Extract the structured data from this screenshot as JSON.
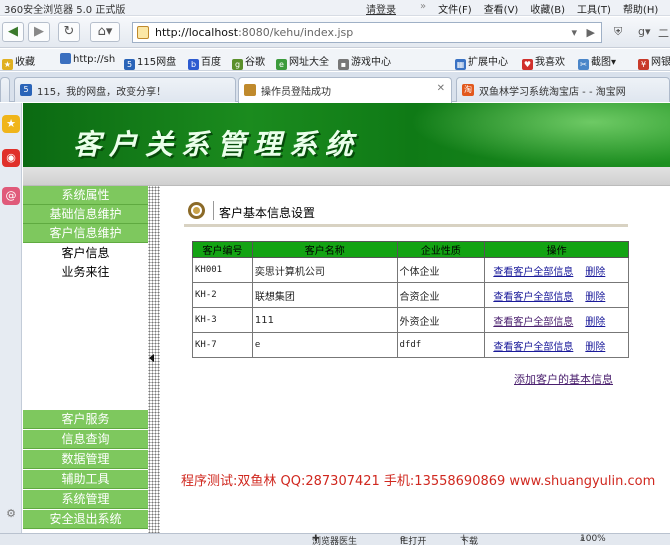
{
  "browser": {
    "app_title": "360安全浏览器 5.0 正式版",
    "login": "请登录",
    "menu": [
      "文件(F)",
      "查看(V)",
      "收藏(B)",
      "工具(T)",
      "帮助(H)"
    ],
    "url_host": "http://localhost",
    "url_rest": ":8080/kehu/index.jsp",
    "bookmarks": [
      {
        "label": "收藏",
        "icon": "star-icon"
      },
      {
        "label": "http://sh",
        "icon": "page-icon"
      },
      {
        "label": "115网盘",
        "icon": "115-icon"
      },
      {
        "label": "百度",
        "icon": "baidu-icon"
      },
      {
        "label": "谷歌",
        "icon": "google-icon"
      },
      {
        "label": "网址大全",
        "icon": "globe-icon"
      },
      {
        "label": "游戏中心",
        "icon": "gamepad-icon"
      },
      {
        "label": "扩展中心",
        "icon": "extension-icon"
      },
      {
        "label": "我喜欢",
        "icon": "heart-icon"
      },
      {
        "label": "截图",
        "icon": "scissors-icon"
      },
      {
        "label": "网银",
        "icon": "bank-icon"
      }
    ],
    "tabs": [
      {
        "label": "115，我的网盘，改变分享！",
        "icon": "115-icon",
        "active": false
      },
      {
        "label": "操作员登陆成功",
        "icon": "page-icon",
        "active": true
      },
      {
        "label": "双鱼林学习系统淘宝店 - - 淘宝网",
        "icon": "taobao-icon",
        "active": false
      }
    ],
    "status": {
      "doctor": "浏览器医生",
      "ie": "IE打开",
      "download": "下载",
      "zoom": "100%"
    }
  },
  "page": {
    "banner_title": "客户关系管理系统",
    "menu_top": [
      "系统属性",
      "基础信息维护",
      "客户信息维护"
    ],
    "submenu": [
      "客户信息",
      "业务来往"
    ],
    "menu_bottom": [
      "客户服务",
      "信息查询",
      "数据管理",
      "辅助工具",
      "系统管理",
      "安全退出系统"
    ],
    "section_title": "客户基本信息设置",
    "table": {
      "headers": [
        "客户编号",
        "客户名称",
        "企业性质",
        "操作"
      ],
      "rows": [
        {
          "id": "KH001",
          "name": "奕思计算机公司",
          "type": "个体企业",
          "view": "查看客户全部信息",
          "delete": "删除"
        },
        {
          "id": "KH-2",
          "name": "联想集团",
          "type": "合资企业",
          "view": "查看客户全部信息",
          "delete": "删除"
        },
        {
          "id": "KH-3",
          "name": "111",
          "type": "外资企业",
          "view": "查看客户全部信息",
          "delete": "删除"
        },
        {
          "id": "KH-7",
          "name": "e",
          "type": "dfdf",
          "view": "查看客户全部信息",
          "delete": "删除"
        }
      ]
    },
    "add_link": "添加客户的基本信息",
    "footer": "程序测试:双鱼林 QQ:287307421 手机:13558690869 www.shuangyulin.com"
  }
}
